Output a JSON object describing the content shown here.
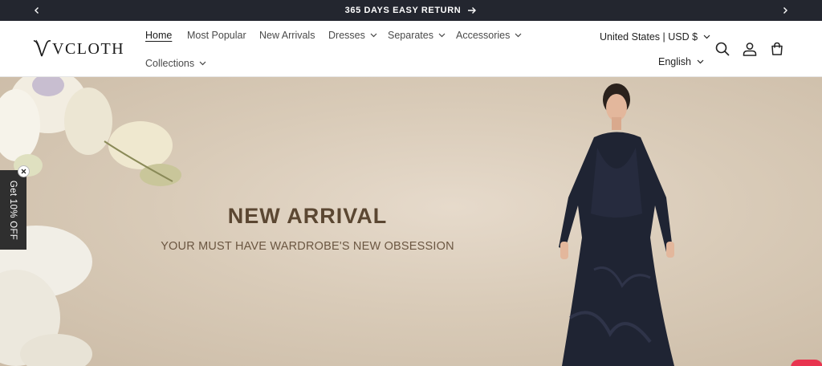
{
  "announcement": {
    "message": "365 DAYS EASY RETURN",
    "prev_icon": "chevron-left-icon",
    "next_icon": "chevron-right-icon"
  },
  "brand": {
    "logo_text": "VCLOTH",
    "logo_mark": "V"
  },
  "nav": {
    "items": [
      {
        "label": "Home",
        "active": true,
        "dropdown": false
      },
      {
        "label": "Most Popular",
        "active": false,
        "dropdown": false
      },
      {
        "label": "New Arrivals",
        "active": false,
        "dropdown": false
      },
      {
        "label": "Dresses",
        "active": false,
        "dropdown": true
      },
      {
        "label": "Separates",
        "active": false,
        "dropdown": true
      },
      {
        "label": "Accessories",
        "active": false,
        "dropdown": true
      },
      {
        "label": "Collections",
        "active": false,
        "dropdown": true
      }
    ]
  },
  "locale": {
    "country_currency": "United States | USD $",
    "language": "English"
  },
  "header_icons": [
    "search-icon",
    "account-icon",
    "cart-icon"
  ],
  "hero": {
    "title": "NEW ARRIVAL",
    "subtitle": "YOUR MUST HAVE WARDROBE'S NEW OBSESSION"
  },
  "discount_tab": {
    "label": "Get 10% OFF"
  },
  "colors": {
    "announcement_bg": "#23262f",
    "hero_text": "#5b4732",
    "accent_red": "#e8344f"
  }
}
